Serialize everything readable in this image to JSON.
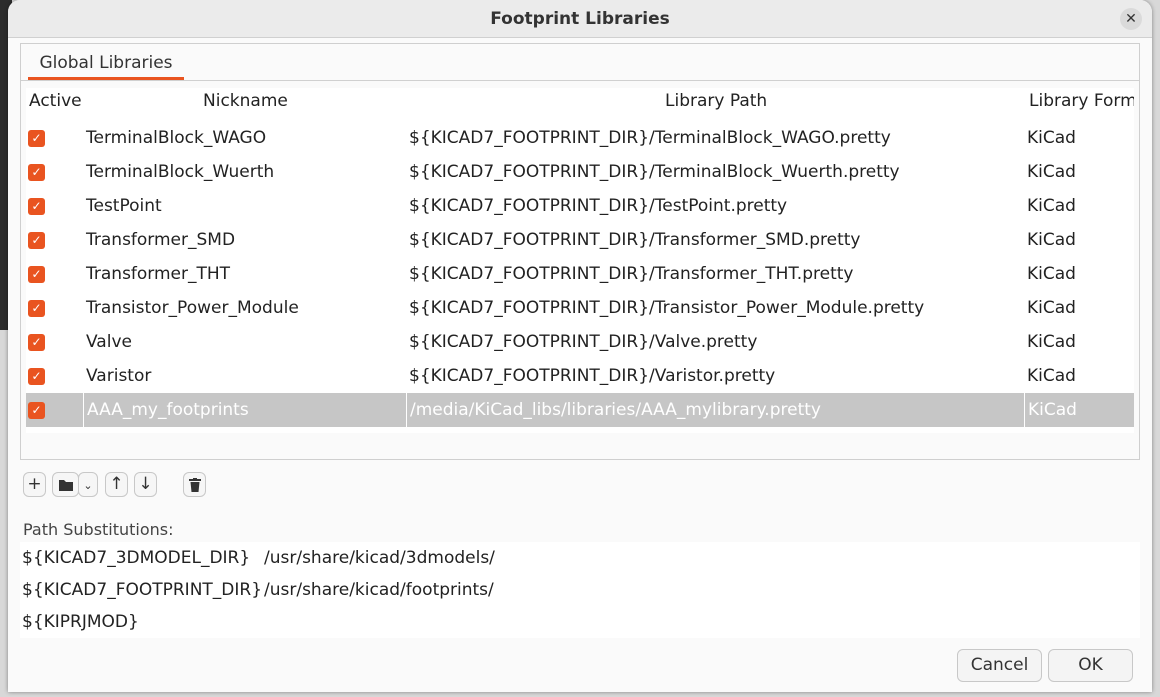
{
  "dialog": {
    "title": "Footprint Libraries",
    "close_icon": "close-icon"
  },
  "tabs": [
    {
      "label": "Global Libraries",
      "active": true
    }
  ],
  "table": {
    "headers": [
      "Active",
      "Nickname",
      "Library Path",
      "Library Form"
    ],
    "rows": [
      {
        "active": true,
        "nickname": "TerminalBlock_WAGO",
        "path": "${KICAD7_FOOTPRINT_DIR}/TerminalBlock_WAGO.pretty",
        "format": "KiCad"
      },
      {
        "active": true,
        "nickname": "TerminalBlock_Wuerth",
        "path": "${KICAD7_FOOTPRINT_DIR}/TerminalBlock_Wuerth.pretty",
        "format": "KiCad"
      },
      {
        "active": true,
        "nickname": "TestPoint",
        "path": "${KICAD7_FOOTPRINT_DIR}/TestPoint.pretty",
        "format": "KiCad"
      },
      {
        "active": true,
        "nickname": "Transformer_SMD",
        "path": "${KICAD7_FOOTPRINT_DIR}/Transformer_SMD.pretty",
        "format": "KiCad"
      },
      {
        "active": true,
        "nickname": "Transformer_THT",
        "path": "${KICAD7_FOOTPRINT_DIR}/Transformer_THT.pretty",
        "format": "KiCad"
      },
      {
        "active": true,
        "nickname": "Transistor_Power_Module",
        "path": "${KICAD7_FOOTPRINT_DIR}/Transistor_Power_Module.pretty",
        "format": "KiCad"
      },
      {
        "active": true,
        "nickname": "Valve",
        "path": "${KICAD7_FOOTPRINT_DIR}/Valve.pretty",
        "format": "KiCad"
      },
      {
        "active": true,
        "nickname": "Varistor",
        "path": "${KICAD7_FOOTPRINT_DIR}/Varistor.pretty",
        "format": "KiCad"
      },
      {
        "active": true,
        "nickname": "AAA_my_footprints",
        "path": "/media/KiCad_libs/libraries/AAA_mylibrary.pretty",
        "format": "KiCad",
        "selected": true
      }
    ]
  },
  "toolbar": {
    "add": "+",
    "browse": "folder-icon",
    "dropdown": "chevron-down-icon",
    "up": "arrow-up-icon",
    "down": "arrow-down-icon",
    "delete": "trash-icon"
  },
  "path_substitutions": {
    "label": "Path Substitutions:",
    "rows": [
      {
        "name": "${KICAD7_3DMODEL_DIR}",
        "value": "/usr/share/kicad/3dmodels/"
      },
      {
        "name": "${KICAD7_FOOTPRINT_DIR}",
        "value": "/usr/share/kicad/footprints/"
      },
      {
        "name": "${KIPRJMOD}",
        "value": ""
      }
    ]
  },
  "buttons": {
    "cancel": "Cancel",
    "ok": "OK"
  },
  "colors": {
    "accent": "#e95420",
    "selection": "#c6c6c6"
  }
}
